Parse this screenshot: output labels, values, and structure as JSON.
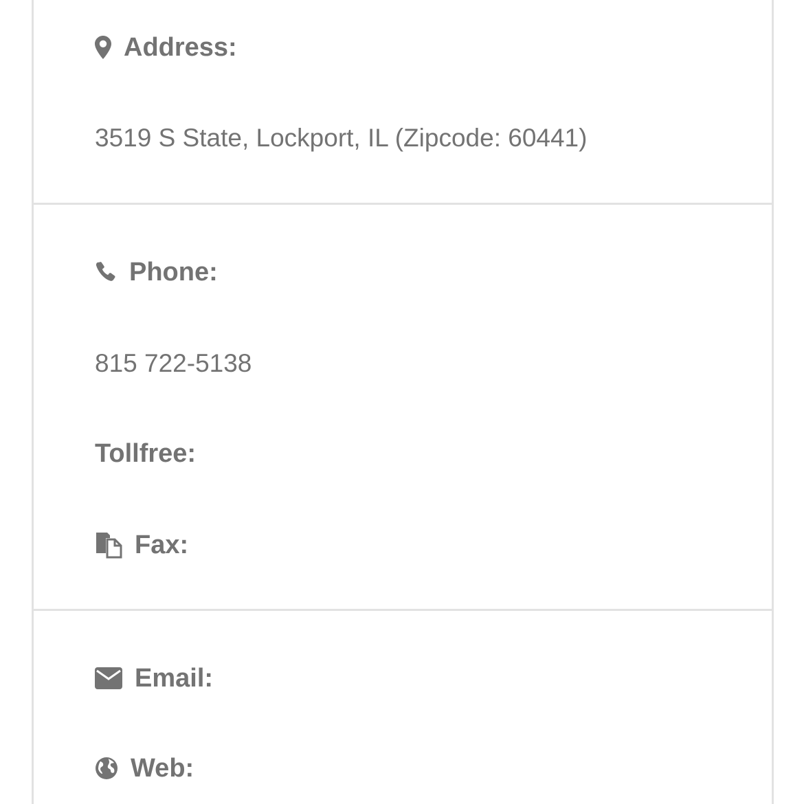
{
  "address": {
    "label": "Address:",
    "icon": "map-marker-icon",
    "value": "3519 S State, Lockport, IL (Zipcode: 60441)"
  },
  "phone": {
    "label": "Phone:",
    "icon": "phone-icon",
    "value": "815 722-5138"
  },
  "tollfree": {
    "label": "Tollfree:"
  },
  "fax": {
    "label": "Fax:",
    "icon": "fax-icon"
  },
  "email": {
    "label": "Email:",
    "icon": "envelope-icon"
  },
  "web": {
    "label": "Web:",
    "icon": "globe-icon"
  },
  "colors": {
    "text": "#737373",
    "border": "#e2e2e2",
    "background": "#ffffff"
  }
}
